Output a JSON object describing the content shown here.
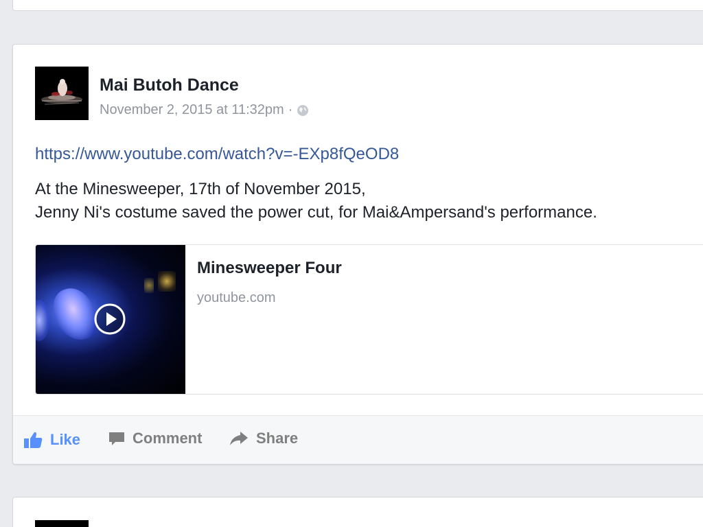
{
  "post": {
    "author": "Mai Butoh Dance",
    "timestamp": "November 2, 2015 at 11:32pm",
    "separator": "·",
    "privacy_icon": "globe-icon",
    "link_url": "https://www.youtube.com/watch?v=-EXp8fQeOD8",
    "text_line1": "At the Minesweeper, 17th of November 2015,",
    "text_line2": "Jenny Ni's costume saved the power cut, for Mai&Ampersand's performance."
  },
  "preview": {
    "title": "Minesweeper Four",
    "domain": "youtube.com",
    "play_icon": "play-icon"
  },
  "actions": {
    "like_label": "Like",
    "comment_label": "Comment",
    "share_label": "Share"
  },
  "colors": {
    "link": "#365899",
    "like_blue": "#5890ff",
    "meta_gray": "#90949c",
    "background": "#e9ebee"
  }
}
